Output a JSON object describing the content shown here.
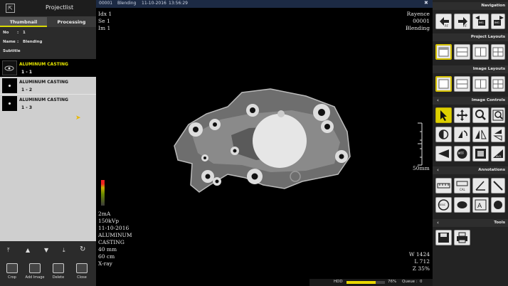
{
  "left_panel": {
    "title": "Projectlist",
    "tabs": [
      "Thumbnail",
      "Processing"
    ],
    "info": {
      "no_label": "No",
      "no_value": "1",
      "name_label": "Name",
      "name_value": "Blending",
      "subtitle_label": "Subtitle"
    },
    "thumbnails": [
      {
        "name": "ALUMINUM CASTING",
        "series": "1 - 1",
        "selected": true
      },
      {
        "name": "ALUMINUM CASTING",
        "series": "1 - 2",
        "selected": false
      },
      {
        "name": "ALUMINUM CASTING",
        "series": "1 - 3",
        "selected": false
      }
    ],
    "nav_icons": [
      "first-icon",
      "up-icon",
      "down-icon",
      "last-icon",
      "refresh-icon"
    ],
    "actions": [
      "Crop",
      "Add Image",
      "Delete",
      "Close"
    ]
  },
  "viewer": {
    "header": {
      "id": "00001",
      "mode": "Blending",
      "date": "11-10-2016",
      "time": "13:56:29"
    },
    "top_left": [
      "Idx 1",
      "Se 1",
      "Im 1"
    ],
    "top_right": [
      "Rayence",
      "00001",
      "Blending"
    ],
    "bottom_left": [
      "2mA",
      "150kVp",
      "11-10-2016",
      "ALUMINUM",
      "CASTING",
      "40 mm",
      "60 cm",
      "X-ray"
    ],
    "bottom_right": [
      "W 1424",
      "L 712",
      "Z 35%"
    ],
    "scale_label": "50mm"
  },
  "right_panel": {
    "sections": {
      "navigation": "Navigation",
      "project_layouts": "Project Layouts",
      "image_layouts": "Image Layouts",
      "image_controls": "Image Controls",
      "annotations": "Annotations",
      "tools": "Tools"
    },
    "nav_labels": [
      "P.F",
      "P.F",
      "IMG",
      "IMG"
    ],
    "control_labels": [
      "MTF",
      "AVG"
    ],
    "annotation_labels": [
      "CAL",
      "SEAC"
    ]
  },
  "status": {
    "hdd_label": "HDD",
    "hdd_percent": "76%",
    "hdd_fraction": 0.76,
    "queue_label": "Queue :",
    "queue_value": "0"
  },
  "colors": {
    "accent_yellow": "#d6c200",
    "header_blue": "#1c2a44"
  }
}
